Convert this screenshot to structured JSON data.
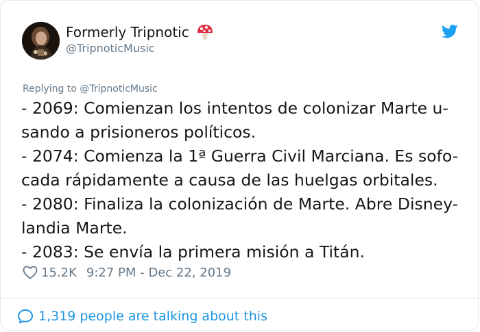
{
  "author": {
    "display_name": "Formerly Tripnotic",
    "handle": "@TripnoticMusic",
    "emoji_icon": "mushroom-icon",
    "avatar_icon": "avatar"
  },
  "platform_icon": "twitter-bird-icon",
  "reply_context": "Replying to @TripnoticMusic",
  "tweet_lines": [
    "- 2069: Comienzan los intentos de colonizar Marte u-",
    "sando a prisioneros políticos.",
    "- 2074: Comienza la 1ª Guerra Civil Marciana. Es sofo-",
    "cada rápidamente a causa de las huelgas orbitales.",
    "- 2080: Finaliza la colonización de Marte. Abre Disney-",
    "landia Marte.",
    "- 2083: Se envía la primera misión a Titán."
  ],
  "stats": {
    "likes": "15.2K",
    "timestamp": "9:27 PM - Dec 22, 2019"
  },
  "footer": {
    "talking_text": "1,319 people are talking about this"
  },
  "colors": {
    "link_blue": "#1b95e0",
    "secondary_gray": "#657786",
    "text": "#14171a",
    "twitter_blue": "#1da1f2",
    "border": "#e1e8ed"
  }
}
